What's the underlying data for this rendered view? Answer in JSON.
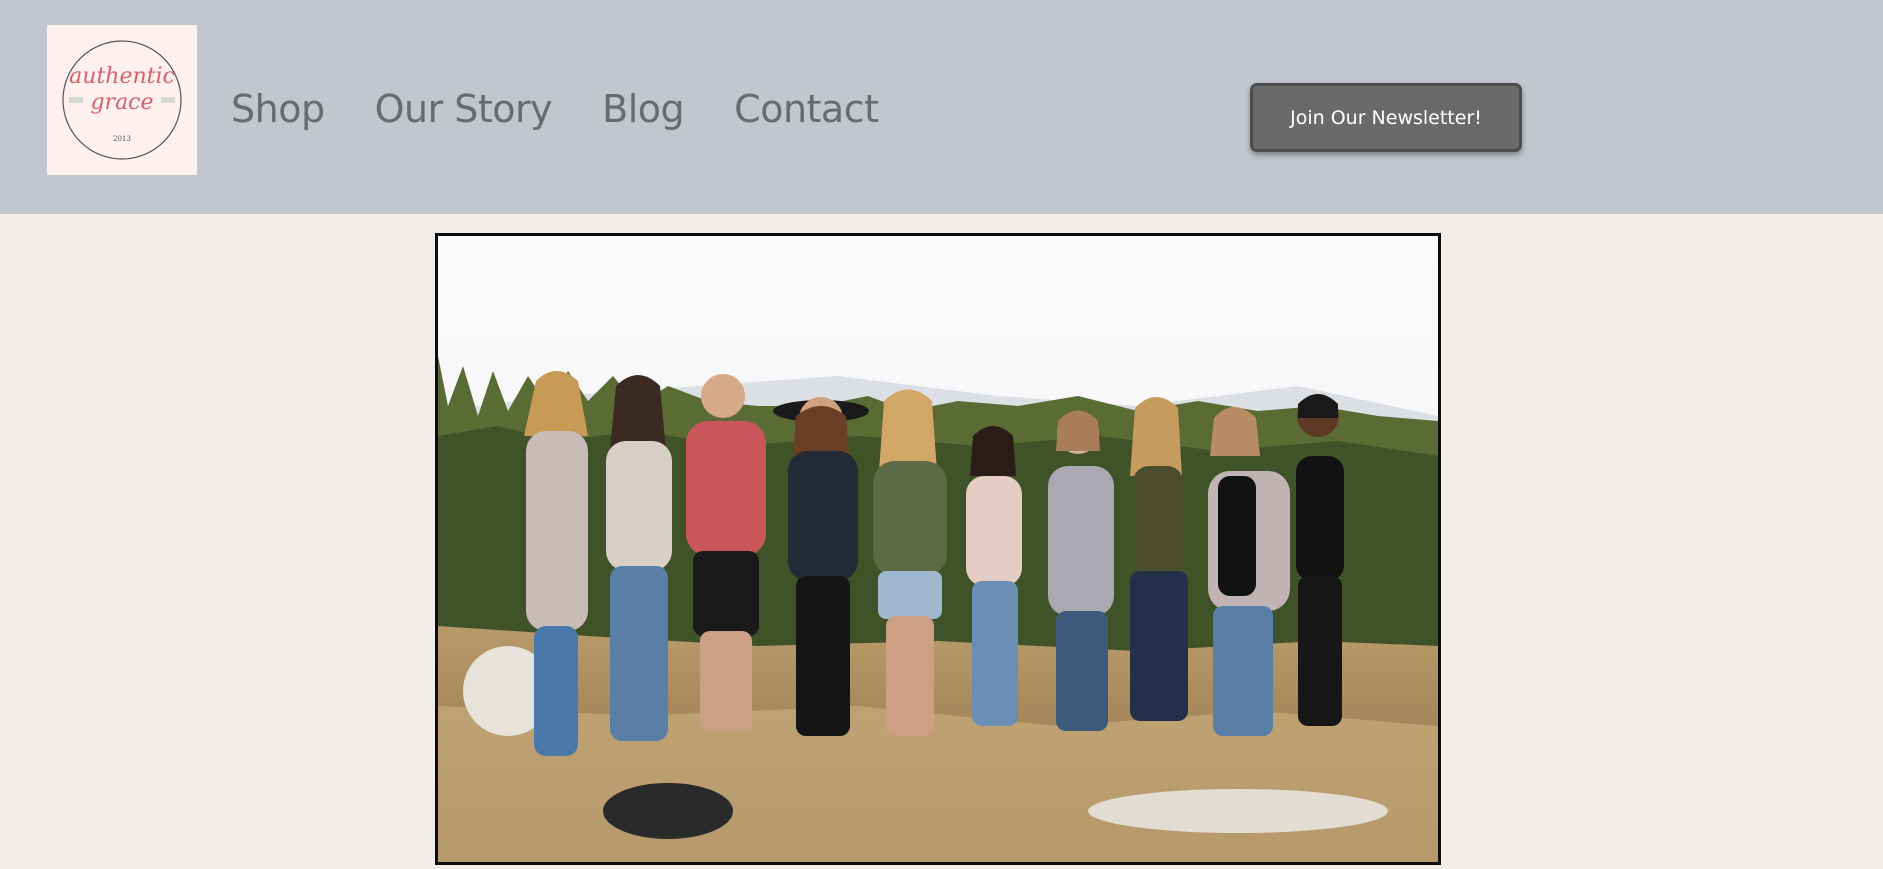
{
  "brand": {
    "logo_line1": "authentic",
    "logo_line2": "grace",
    "logo_year": "2013",
    "logo_bg": "#fdf0ee",
    "logo_accent": "#d4636c"
  },
  "nav": {
    "items": [
      {
        "label": "Shop"
      },
      {
        "label": "Our Story"
      },
      {
        "label": "Blog"
      },
      {
        "label": "Contact"
      }
    ]
  },
  "cta": {
    "label": "Join Our Newsletter!",
    "color": "#6a6a6a"
  },
  "hero": {
    "subject": "group-photo-icon"
  },
  "theme": {
    "header_bg": "#c1c7cd",
    "page_bg": "#f0edeb",
    "nav_color": "#6b6b6b"
  }
}
